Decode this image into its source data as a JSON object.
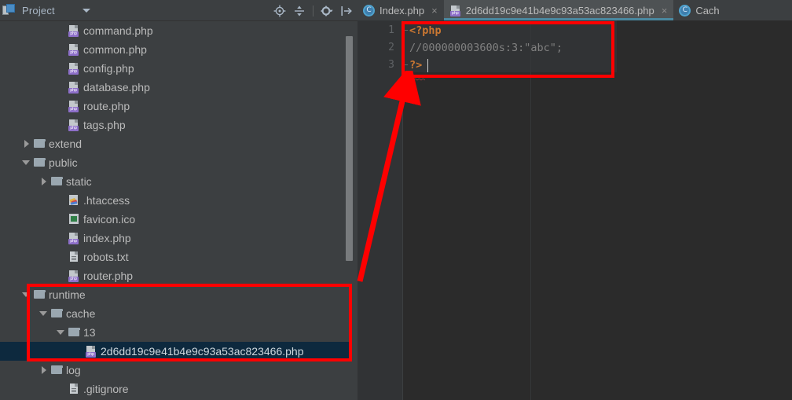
{
  "window": {
    "theme_accent": "#4a88a0",
    "annotation_color": "#ff0000"
  },
  "project_panel": {
    "title": "Project",
    "panel_icon": "project-module-icon",
    "dropdown_icon": "chevron-down-icon",
    "tools": [
      {
        "name": "locate-in-tree-icon",
        "glyph": "locate"
      },
      {
        "name": "collapse-all-icon",
        "glyph": "collapse"
      },
      {
        "name": "settings-gear-icon",
        "glyph": "gear"
      },
      {
        "name": "hide-panel-icon",
        "glyph": "hide"
      }
    ]
  },
  "tree": {
    "items": [
      {
        "label": "command.php",
        "icon": "php-file-icon",
        "indent": 3,
        "twisty": "none",
        "selected": false
      },
      {
        "label": "common.php",
        "icon": "php-file-icon",
        "indent": 3,
        "twisty": "none",
        "selected": false
      },
      {
        "label": "config.php",
        "icon": "php-file-icon",
        "indent": 3,
        "twisty": "none",
        "selected": false
      },
      {
        "label": "database.php",
        "icon": "php-file-icon",
        "indent": 3,
        "twisty": "none",
        "selected": false
      },
      {
        "label": "route.php",
        "icon": "php-file-icon",
        "indent": 3,
        "twisty": "none",
        "selected": false
      },
      {
        "label": "tags.php",
        "icon": "php-file-icon",
        "indent": 3,
        "twisty": "none",
        "selected": false
      },
      {
        "label": "extend",
        "icon": "folder-icon",
        "indent": 1,
        "twisty": "collapsed",
        "selected": false
      },
      {
        "label": "public",
        "icon": "folder-icon",
        "indent": 1,
        "twisty": "expanded",
        "selected": false
      },
      {
        "label": "static",
        "icon": "folder-icon",
        "indent": 2,
        "twisty": "collapsed",
        "selected": false
      },
      {
        "label": ".htaccess",
        "icon": "htaccess-file-icon",
        "indent": 3,
        "twisty": "none",
        "selected": false
      },
      {
        "label": "favicon.ico",
        "icon": "image-file-icon",
        "indent": 3,
        "twisty": "none",
        "selected": false
      },
      {
        "label": "index.php",
        "icon": "php-file-icon",
        "indent": 3,
        "twisty": "none",
        "selected": false
      },
      {
        "label": "robots.txt",
        "icon": "text-file-icon",
        "indent": 3,
        "twisty": "none",
        "selected": false
      },
      {
        "label": "router.php",
        "icon": "php-file-icon",
        "indent": 3,
        "twisty": "none",
        "selected": false
      },
      {
        "label": "runtime",
        "icon": "folder-icon",
        "indent": 1,
        "twisty": "expanded",
        "selected": false
      },
      {
        "label": "cache",
        "icon": "folder-icon",
        "indent": 2,
        "twisty": "expanded",
        "selected": false
      },
      {
        "label": "13",
        "icon": "folder-icon",
        "indent": 3,
        "twisty": "expanded",
        "selected": false
      },
      {
        "label": "2d6dd19c9e41b4e9c93a53ac823466.php",
        "icon": "php-file-icon",
        "indent": 4,
        "twisty": "none",
        "selected": true
      },
      {
        "label": "log",
        "icon": "folder-icon",
        "indent": 2,
        "twisty": "collapsed",
        "selected": false
      },
      {
        "label": ".gitignore",
        "icon": "text-file-icon",
        "indent": 3,
        "twisty": "none",
        "selected": false
      }
    ]
  },
  "editor": {
    "tabs": [
      {
        "label": "Index.php",
        "icon": "class-file-icon",
        "active": false,
        "closable": true
      },
      {
        "label": "2d6dd19c9e41b4e9c93a53ac823466.php",
        "icon": "php-file-icon",
        "active": true,
        "closable": true
      },
      {
        "label": "Cach",
        "icon": "class-file-icon",
        "active": false,
        "closable": false
      }
    ],
    "line_numbers": [
      "1",
      "2",
      "3"
    ],
    "lines": [
      {
        "n": "1",
        "text": "<?php",
        "type": "keyword"
      },
      {
        "n": "2",
        "text": "//000000003600s:3:\"abc\";",
        "type": "comment"
      },
      {
        "n": "3",
        "text": "?>",
        "type": "keyword"
      }
    ]
  },
  "annotations": {
    "code_box": "red-rectangle-around-code",
    "tree_box": "red-rectangle-around-runtime-cache",
    "arrow": "red-arrow-tree-to-code"
  }
}
